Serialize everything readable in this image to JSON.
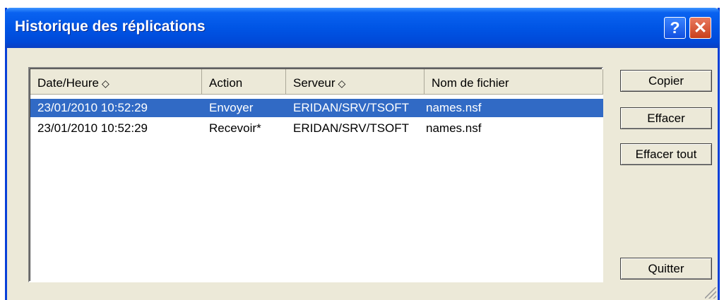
{
  "window": {
    "title": "Historique des réplications",
    "help_label": "?",
    "close_label": "✕"
  },
  "list": {
    "columns": [
      {
        "label": "Date/Heure",
        "sortable": true
      },
      {
        "label": "Action",
        "sortable": false
      },
      {
        "label": "Serveur",
        "sortable": true
      },
      {
        "label": "Nom de fichier",
        "sortable": false
      }
    ],
    "sort_icon": "◇",
    "rows": [
      {
        "date": "23/01/2010 10:52:29",
        "action": "Envoyer",
        "server": "ERIDAN/SRV/TSOFT",
        "file": "names.nsf",
        "selected": true
      },
      {
        "date": "23/01/2010 10:52:29",
        "action": "Recevoir*",
        "server": "ERIDAN/SRV/TSOFT",
        "file": "names.nsf",
        "selected": false
      }
    ]
  },
  "buttons": {
    "copy": "Copier",
    "delete": "Effacer",
    "delete_all": "Effacer tout",
    "quit": "Quitter"
  },
  "colors": {
    "titlebar": "#0055e5",
    "selection": "#316ac5",
    "dialog_bg": "#ece9d8"
  }
}
